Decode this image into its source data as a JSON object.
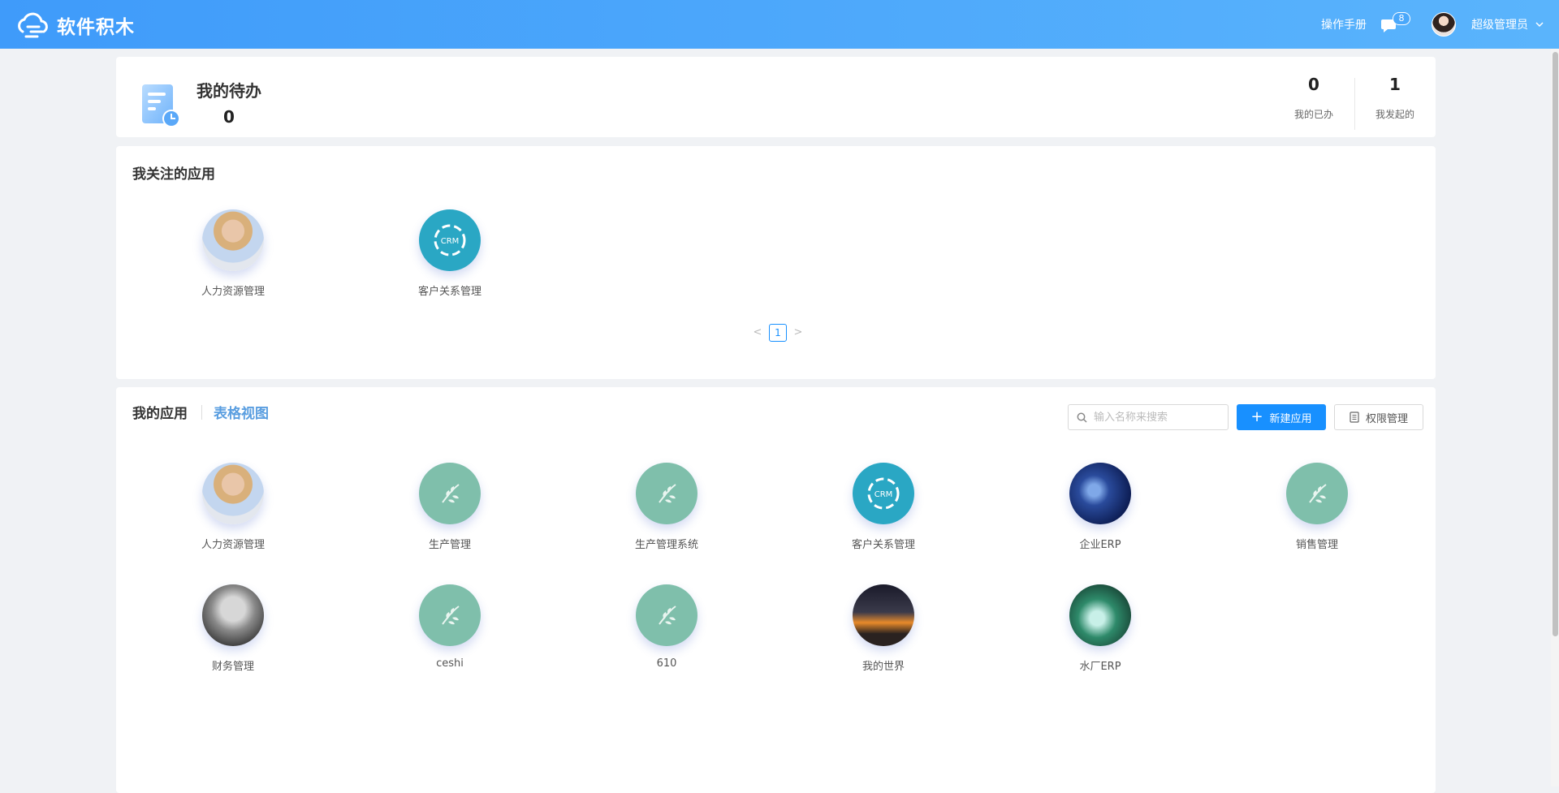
{
  "header": {
    "logo_text": "软件积木",
    "manual_label": "操作手册",
    "message_count": "8",
    "user_name": "超级管理员"
  },
  "todo": {
    "title": "我的待办",
    "count": "0",
    "done": {
      "value": "0",
      "label": "我的已办"
    },
    "started": {
      "value": "1",
      "label": "我发起的"
    }
  },
  "favorites": {
    "title": "我关注的应用",
    "apps": [
      {
        "label": "人力资源管理",
        "icon": "hr-photo-icon"
      },
      {
        "label": "客户关系管理",
        "icon": "crm-icon"
      }
    ],
    "pagination": {
      "current": "1",
      "prev": "<",
      "next": ">"
    }
  },
  "my_apps": {
    "tab_mine": "我的应用",
    "tab_table": "表格视图",
    "search_placeholder": "输入名称来搜索",
    "new_button": "新建应用",
    "new_button_plus": "+",
    "perm_button": "权限管理",
    "apps": [
      {
        "label": "人力资源管理",
        "icon": "hr-photo-icon"
      },
      {
        "label": "生产管理",
        "icon": "leaf-icon"
      },
      {
        "label": "生产管理系统",
        "icon": "leaf-icon"
      },
      {
        "label": "客户关系管理",
        "icon": "crm-icon"
      },
      {
        "label": "企业ERP",
        "icon": "erp-photo-icon"
      },
      {
        "label": "销售管理",
        "icon": "leaf-icon"
      },
      {
        "label": "财务管理",
        "icon": "finance-photo-icon"
      },
      {
        "label": "ceshi",
        "icon": "leaf-icon"
      },
      {
        "label": "610",
        "icon": "leaf-icon"
      },
      {
        "label": "我的世界",
        "icon": "world-photo-icon"
      },
      {
        "label": "水厂ERP",
        "icon": "water-photo-icon"
      }
    ]
  },
  "colors": {
    "header_start": "#3f9bfa",
    "header_end": "#5ab4fc",
    "primary": "#1890ff",
    "leaf_bg": "#7fbfab",
    "crm_bg": "#2aa7c4",
    "tab_table": "#5a9ee0"
  }
}
